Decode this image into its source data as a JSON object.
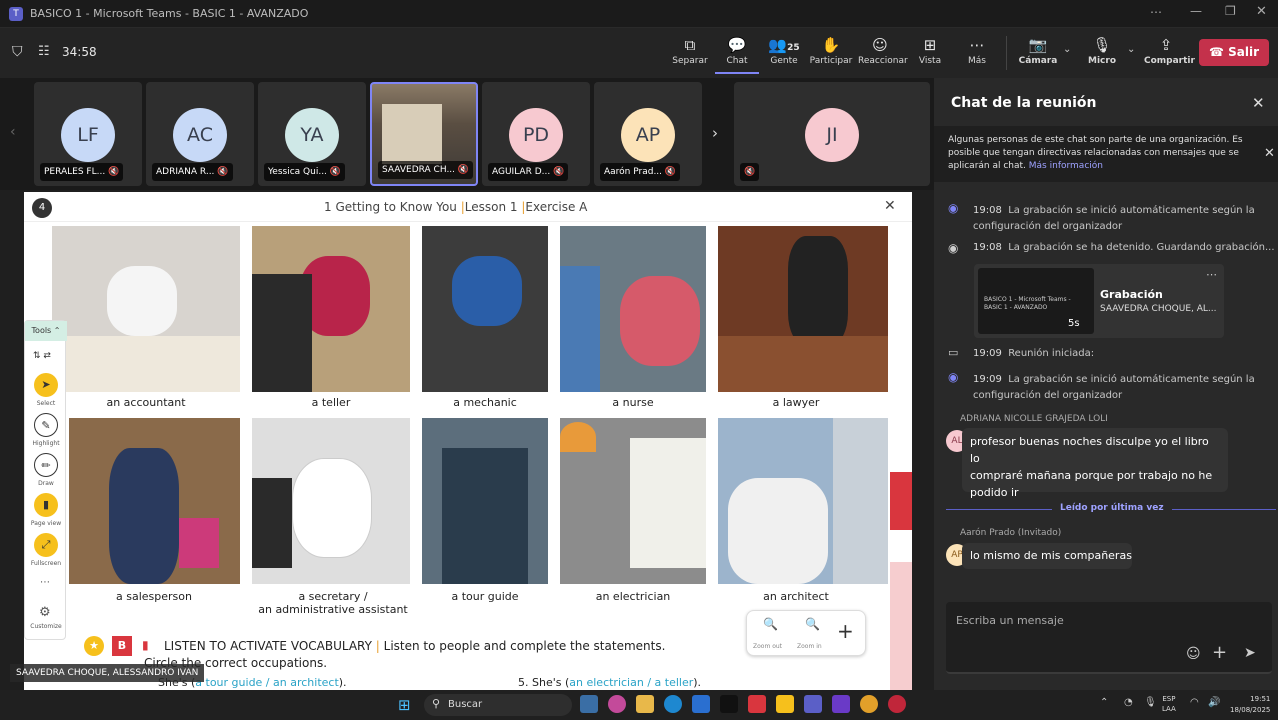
{
  "window": {
    "title": "BASICO 1 - Microsoft Teams - BASIC 1 - AVANZADO"
  },
  "toolbar": {
    "timer": "34:58",
    "people_count": "25",
    "buttons": [
      "Separar",
      "Chat",
      "Gente",
      "Participar",
      "Reaccionar",
      "Vista",
      "Más",
      "Cámara",
      "Micro",
      "Compartir"
    ],
    "leave": "Salir"
  },
  "participants": [
    {
      "initials": "LF",
      "name": "PERALES FL...",
      "color": "#c7d9f7"
    },
    {
      "initials": "AC",
      "name": "ADRIANA R...",
      "color": "#c7d9f7"
    },
    {
      "initials": "YA",
      "name": "Yessica Qui...",
      "color": "#cfe8e7"
    },
    {
      "initials": "",
      "name": "SAAVEDRA CH...",
      "color": "#6b5d4e"
    },
    {
      "initials": "PD",
      "name": "AGUILAR D...",
      "color": "#f7c9d0"
    },
    {
      "initials": "AP",
      "name": "Aarón Prad...",
      "color": "#fce3b8"
    },
    {
      "initials": "JI",
      "name": "",
      "color": "#f7c9d0"
    }
  ],
  "slide": {
    "badge": "4",
    "heading": "1 Getting to Know You",
    "lesson": "Lesson 1",
    "exercise": "Exercise A",
    "tools_label": "Tools",
    "tools": [
      "Select",
      "Highlight",
      "Draw",
      "Page view",
      "Fullscreen",
      "Customize"
    ],
    "occupations": [
      {
        "label": "an accountant",
        "bg": "#d8d4cf",
        "fg": "#f5f5f5"
      },
      {
        "label": "a teller",
        "bg": "#b8a07a",
        "fg": "#b8244a"
      },
      {
        "label": "a mechanic",
        "bg": "#3c3c3c",
        "fg": "#2a5ea8"
      },
      {
        "label": "a nurse",
        "bg": "#6a7a84",
        "fg": "#d65a6a"
      },
      {
        "label": "a lawyer",
        "bg": "#6e3a24",
        "fg": "#222222"
      },
      {
        "label": "a salesperson",
        "bg": "#8a6a4a",
        "fg": "#2a3a5e"
      },
      {
        "label": "a secretary /",
        "label2": "an administrative assistant",
        "bg": "#dedede",
        "fg": "#ffffff"
      },
      {
        "label": "a tour guide",
        "bg": "#5c6e7c",
        "fg": "#2a3c4c"
      },
      {
        "label": "an electrician",
        "bg": "#8c8c8c",
        "fg": "#e89a3a"
      },
      {
        "label": "an architect",
        "bg": "#9cb4cc",
        "fg": "#f0f0f0"
      }
    ],
    "zoom_out": "Zoom out",
    "zoom_in": "Zoom in",
    "activity_icon": "B",
    "activity_title": "LISTEN TO ACTIVATE VOCABULARY",
    "activity_instr": "Listen to people and complete the statements.",
    "activity_instr2": "Circle the correct occupations.",
    "q_left_prefix": "She's",
    "q_left": "a tour guide / an architect",
    "q_right_prefix": "5. She's",
    "q_right": "an electrician / a teller",
    "speaker": "SAAVEDRA CHOQUE, ALESSANDRO IVAN"
  },
  "chat": {
    "title": "Chat de la reunión",
    "notice": "Algunas personas de este chat son parte de una organización. Es posible que tengan directivas relacionadas con mensajes que se aplicarán al chat.",
    "notice_link": "Más información",
    "events": [
      {
        "time": "19:08",
        "text": "La grabación se inició automáticamente según la",
        "text2": "configuración del organizador"
      },
      {
        "time": "19:08",
        "text": "La grabación se ha detenido. Guardando grabación..."
      },
      {
        "time": "19:09",
        "text": "Reunión iniciada:"
      },
      {
        "time": "19:09",
        "text": "La grabación se inició automáticamente según la",
        "text2": "configuración del organizador"
      }
    ],
    "recording": {
      "thumb_title": "BASICO 1 - Microsoft Teams - BASIC 1 - AVANZADO",
      "title": "Grabación",
      "author": "SAAVEDRA CHOQUE, AL...",
      "duration": "5s"
    },
    "messages": [
      {
        "sender": "ADRIANA NICOLLE GRAJEDA LOLI",
        "initials": "AL",
        "lines": [
          "profesor buenas noches disculpe yo el libro lo",
          "compraré mañana porque por trabajo no he",
          "podido ir"
        ]
      },
      {
        "sender": "Aarón Prado (Invitado)",
        "initials": "AP",
        "lines": [
          "lo mismo de mis compañeras"
        ]
      }
    ],
    "read_marker": "Leído por última vez",
    "compose_placeholder": "Escriba un mensaje"
  },
  "taskbar": {
    "search": "Buscar",
    "lang": "ESP",
    "lang2": "LAA",
    "time": "19:51",
    "date": "18/08/2025"
  }
}
